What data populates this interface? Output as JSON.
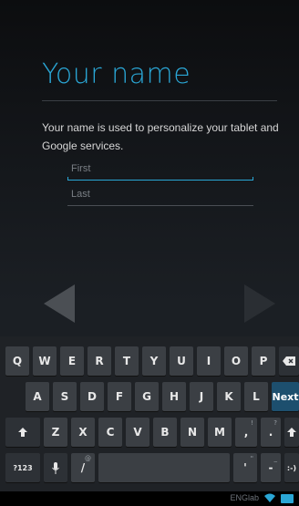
{
  "title": "Your name",
  "description": "Your name is used to personalize your tablet and Google services.",
  "fields": {
    "first_placeholder": "First",
    "last_placeholder": "Last"
  },
  "keyboard": {
    "row1": [
      "Q",
      "W",
      "E",
      "R",
      "T",
      "Y",
      "U",
      "I",
      "O",
      "P"
    ],
    "row2": [
      "A",
      "S",
      "D",
      "F",
      "G",
      "H",
      "J",
      "K",
      "L"
    ],
    "row3": [
      "Z",
      "X",
      "C",
      "V",
      "B",
      "N",
      "M"
    ],
    "next_label": "Next",
    "symbols_label": "?123",
    "slash": "/",
    "slash_sup": "@",
    "comma": ",",
    "comma_sup": "!",
    "period": ".",
    "period_sup": "?",
    "apostrophe": "'",
    "apostrophe_sup": "\"",
    "dash": "-",
    "dash_sup": "_",
    "smiley": ":-)"
  },
  "status": {
    "brand": "ENGlab"
  },
  "colors": {
    "accent": "#2aa6d5",
    "key": "#3b3f44",
    "next_key": "#1d4f6e"
  }
}
